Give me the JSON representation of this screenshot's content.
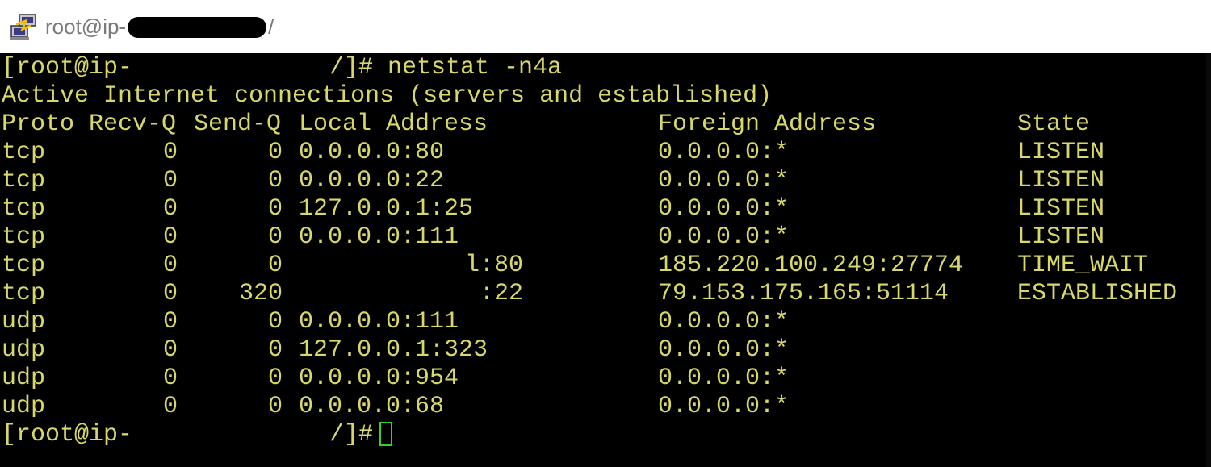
{
  "window": {
    "title_prefix": "root@ip-",
    "title_suffix": "/",
    "icon": "putty-terminal-icon"
  },
  "terminal": {
    "prompt1": {
      "user": "[root@ip-",
      "suffix": "/]# ",
      "command": "netstat -n4a"
    },
    "banner": "Active Internet connections (servers and established)",
    "headers": {
      "proto": "Proto",
      "recvq": "Recv-Q",
      "sendq": "Send-Q",
      "local": "Local Address",
      "foreign": "Foreign Address",
      "state": "State"
    },
    "rows": [
      {
        "proto": "tcp",
        "recvq": "0",
        "sendq": "0",
        "local": "0.0.0.0:80",
        "foreign": "0.0.0.0:*",
        "state": "LISTEN"
      },
      {
        "proto": "tcp",
        "recvq": "0",
        "sendq": "0",
        "local": "0.0.0.0:22",
        "foreign": "0.0.0.0:*",
        "state": "LISTEN"
      },
      {
        "proto": "tcp",
        "recvq": "0",
        "sendq": "0",
        "local": "127.0.0.1:25",
        "foreign": "0.0.0.0:*",
        "state": "LISTEN"
      },
      {
        "proto": "tcp",
        "recvq": "0",
        "sendq": "0",
        "local": "0.0.0.0:111",
        "foreign": "0.0.0.0:*",
        "state": "LISTEN"
      },
      {
        "proto": "tcp",
        "recvq": "0",
        "sendq": "0",
        "local": "l:80",
        "foreign": "185.220.100.249:27774",
        "state": "TIME_WAIT"
      },
      {
        "proto": "tcp",
        "recvq": "0",
        "sendq": "320",
        "local": ":22",
        "foreign": "79.153.175.165:51114",
        "state": "ESTABLISHED"
      },
      {
        "proto": "udp",
        "recvq": "0",
        "sendq": "0",
        "local": "0.0.0.0:111",
        "foreign": "0.0.0.0:*",
        "state": ""
      },
      {
        "proto": "udp",
        "recvq": "0",
        "sendq": "0",
        "local": "127.0.0.1:323",
        "foreign": "0.0.0.0:*",
        "state": ""
      },
      {
        "proto": "udp",
        "recvq": "0",
        "sendq": "0",
        "local": "0.0.0.0:954",
        "foreign": "0.0.0.0:*",
        "state": ""
      },
      {
        "proto": "udp",
        "recvq": "0",
        "sendq": "0",
        "local": "0.0.0.0:68",
        "foreign": "0.0.0.0:*",
        "state": ""
      }
    ],
    "prompt2": {
      "user": "[root@ip-",
      "suffix": "/]#"
    }
  },
  "colors": {
    "terminal_bg": "#000000",
    "terminal_fg": "#d8d86a",
    "cursor": "#2fd22f",
    "title_text": "#7a7a7a"
  }
}
